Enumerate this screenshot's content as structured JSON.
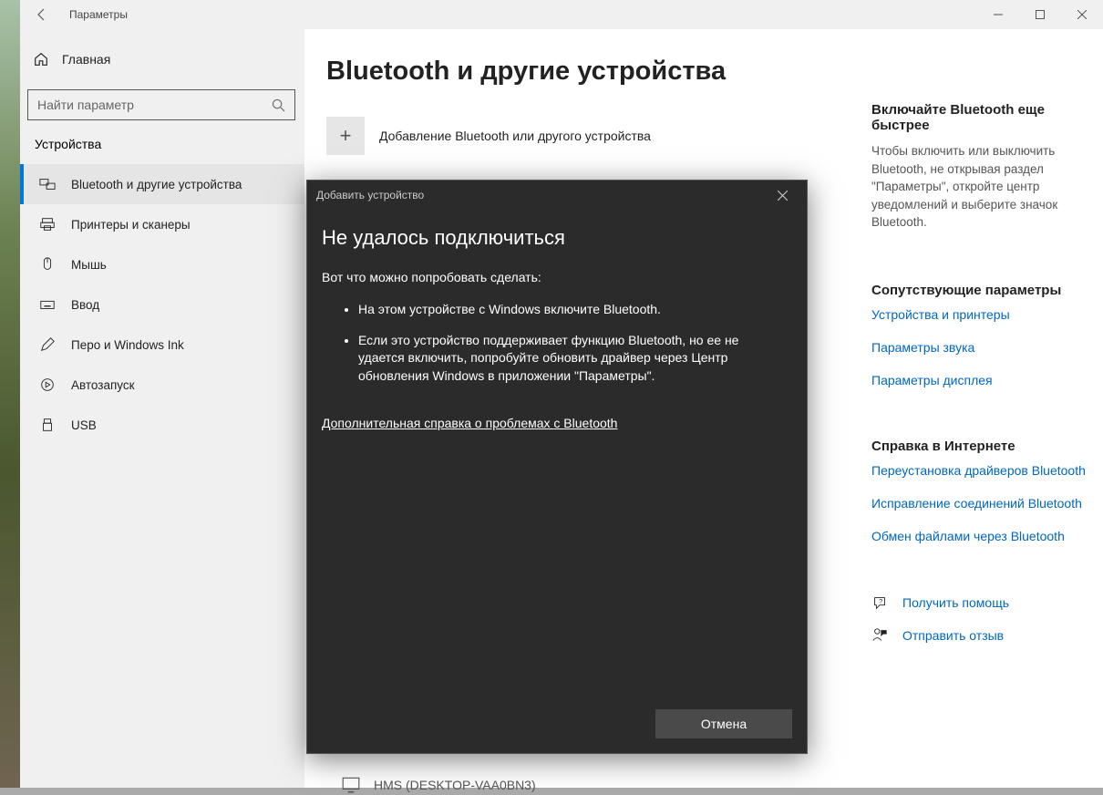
{
  "window": {
    "title": "Параметры"
  },
  "sidebar": {
    "home": "Главная",
    "search_placeholder": "Найти параметр",
    "section": "Устройства",
    "items": [
      {
        "label": "Bluetooth и другие устройства",
        "active": true
      },
      {
        "label": "Принтеры и сканеры"
      },
      {
        "label": "Мышь"
      },
      {
        "label": "Ввод"
      },
      {
        "label": "Перо и Windows Ink"
      },
      {
        "label": "Автозапуск"
      },
      {
        "label": "USB"
      }
    ]
  },
  "main": {
    "title": "Bluetooth и другие устройства",
    "add_label": "Добавление Bluetooth или другого устройства",
    "device_row": "HMS (DESKTOP-VAA0BN3)"
  },
  "right": {
    "title1": "Включайте Bluetooth еще быстрее",
    "text1": "Чтобы включить или выключить Bluetooth, не открывая раздел \"Параметры\", откройте центр уведомлений и выберите значок Bluetooth.",
    "title2": "Сопутствующие параметры",
    "links2": [
      "Устройства и принтеры",
      "Параметры звука",
      "Параметры дисплея"
    ],
    "title3": "Справка в Интернете",
    "links3": [
      "Переустановка драйверов Bluetooth",
      "Исправление соединений Bluetooth",
      "Обмен файлами через Bluetooth"
    ],
    "help": "Получить помощь",
    "feedback": "Отправить отзыв"
  },
  "dialog": {
    "title": "Добавить устройство",
    "heading": "Не удалось подключиться",
    "sub": "Вот что можно попробовать сделать:",
    "bullets": [
      "На этом устройстве с Windows включите Bluetooth.",
      "Если это устройство поддерживает функцию Bluetooth, но ее не удается включить, попробуйте обновить драйвер через Центр обновления Windows в приложении \"Параметры\"."
    ],
    "link": "Дополнительная справка о проблемах с Bluetooth",
    "cancel": "Отмена"
  }
}
